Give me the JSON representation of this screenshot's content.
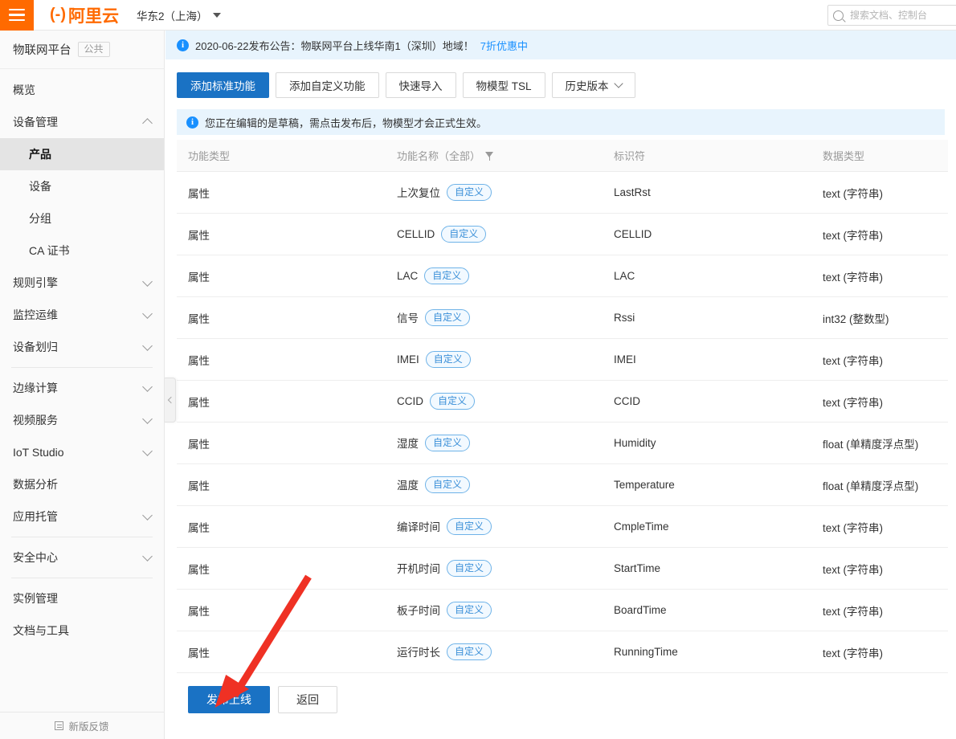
{
  "topbar": {
    "menu_icon": "hamburger-icon",
    "logo_text": "阿里云",
    "logo_mark": "(-)",
    "region": "华东2（上海）",
    "search_placeholder": "搜索文档、控制台"
  },
  "sidebar": {
    "product_name": "物联网平台",
    "product_badge": "公共",
    "items": [
      {
        "label": "概览",
        "level": "top",
        "arrow": "none"
      },
      {
        "label": "设备管理",
        "level": "top",
        "arrow": "up"
      },
      {
        "label": "产品",
        "level": "sub",
        "arrow": "none",
        "active": true
      },
      {
        "label": "设备",
        "level": "sub",
        "arrow": "none"
      },
      {
        "label": "分组",
        "level": "sub",
        "arrow": "none"
      },
      {
        "label": "CA 证书",
        "level": "sub",
        "arrow": "none"
      },
      {
        "label": "规则引擎",
        "level": "top",
        "arrow": "down"
      },
      {
        "label": "监控运维",
        "level": "top",
        "arrow": "down"
      },
      {
        "label": "设备划归",
        "level": "top",
        "arrow": "down"
      },
      {
        "label": "边缘计算",
        "level": "top",
        "arrow": "down",
        "divider_before": true
      },
      {
        "label": "视频服务",
        "level": "top",
        "arrow": "down"
      },
      {
        "label": "IoT Studio",
        "level": "top",
        "arrow": "down"
      },
      {
        "label": "数据分析",
        "level": "top",
        "arrow": "none",
        "external": true
      },
      {
        "label": "应用托管",
        "level": "top",
        "arrow": "down"
      },
      {
        "label": "安全中心",
        "level": "top",
        "arrow": "down",
        "divider_before": true
      },
      {
        "label": "实例管理",
        "level": "top",
        "arrow": "none",
        "divider_before": true
      },
      {
        "label": "文档与工具",
        "level": "top",
        "arrow": "none"
      }
    ],
    "feedback": "新版反馈",
    "collapse_icon": "chevron-left-icon"
  },
  "main": {
    "announcement": {
      "text": "2020-06-22发布公告：物联网平台上线华南1（深圳）地域！",
      "link_text": "7折优惠中"
    },
    "toolbar": [
      {
        "label": "添加标准功能",
        "primary": true
      },
      {
        "label": "添加自定义功能",
        "primary": false
      },
      {
        "label": "快速导入",
        "primary": false
      },
      {
        "label": "物模型 TSL",
        "primary": false
      },
      {
        "label": "历史版本",
        "primary": false,
        "dropdown": true
      }
    ],
    "draft_notice": "您正在编辑的是草稿，需点击发布后，物模型才会正式生效。",
    "table": {
      "headers": [
        "功能类型",
        "功能名称（全部）",
        "标识符",
        "数据类型"
      ],
      "header_filter_col": 1,
      "rows": [
        {
          "type": "属性",
          "name": "上次复位",
          "tag": "自定义",
          "identifier": "LastRst",
          "datatype": "text (字符串)"
        },
        {
          "type": "属性",
          "name": "CELLID",
          "tag": "自定义",
          "identifier": "CELLID",
          "datatype": "text (字符串)"
        },
        {
          "type": "属性",
          "name": "LAC",
          "tag": "自定义",
          "identifier": "LAC",
          "datatype": "text (字符串)"
        },
        {
          "type": "属性",
          "name": "信号",
          "tag": "自定义",
          "identifier": "Rssi",
          "datatype": "int32 (整数型)"
        },
        {
          "type": "属性",
          "name": "IMEI",
          "tag": "自定义",
          "identifier": "IMEI",
          "datatype": "text (字符串)"
        },
        {
          "type": "属性",
          "name": "CCID",
          "tag": "自定义",
          "identifier": "CCID",
          "datatype": "text (字符串)"
        },
        {
          "type": "属性",
          "name": "湿度",
          "tag": "自定义",
          "identifier": "Humidity",
          "datatype": "float (单精度浮点型)"
        },
        {
          "type": "属性",
          "name": "温度",
          "tag": "自定义",
          "identifier": "Temperature",
          "datatype": "float (单精度浮点型)"
        },
        {
          "type": "属性",
          "name": "编译时间",
          "tag": "自定义",
          "identifier": "CmpleTime",
          "datatype": "text (字符串)"
        },
        {
          "type": "属性",
          "name": "开机时间",
          "tag": "自定义",
          "identifier": "StartTime",
          "datatype": "text (字符串)"
        },
        {
          "type": "属性",
          "name": "板子时间",
          "tag": "自定义",
          "identifier": "BoardTime",
          "datatype": "text (字符串)"
        },
        {
          "type": "属性",
          "name": "运行时长",
          "tag": "自定义",
          "identifier": "RunningTime",
          "datatype": "text (字符串)"
        }
      ]
    },
    "footer_buttons": [
      {
        "label": "发布上线",
        "primary": true
      },
      {
        "label": "返回",
        "primary": false
      }
    ]
  },
  "annotation": {
    "shape": "red-arrow",
    "color": "#ef3124"
  },
  "colors": {
    "brand_orange": "#ff6a00",
    "primary_blue": "#1a72c4",
    "info_blue": "#1890ff",
    "notice_bg": "#e8f4fd"
  }
}
